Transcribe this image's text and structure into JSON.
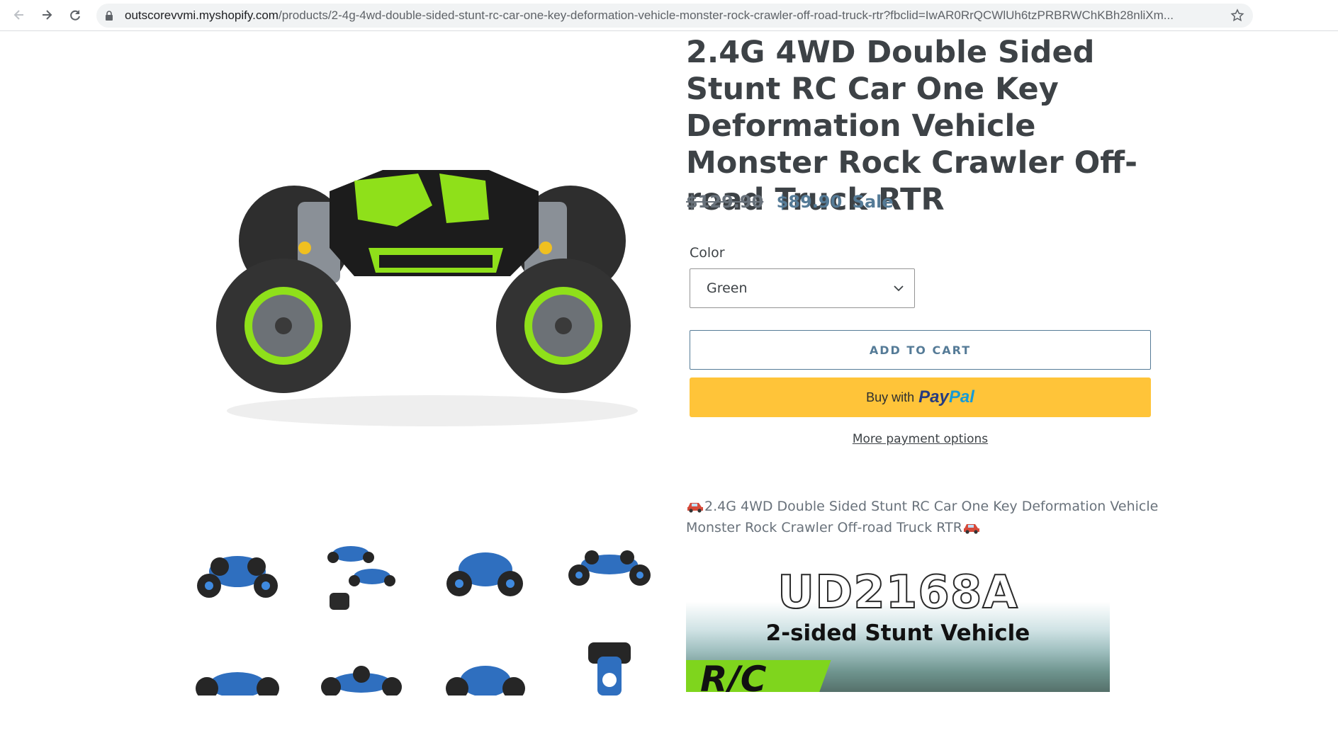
{
  "browser": {
    "url_domain": "outscorevvmi.myshopify.com",
    "url_path": "/products/2-4g-4wd-double-sided-stunt-rc-car-one-key-deformation-vehicle-monster-rock-crawler-off-road-truck-rtr?fbclid=IwAR0RrQCWlUh6tzPRBRWChKBh28nliXm..."
  },
  "product": {
    "title": "2.4G 4WD Double Sided Stunt RC Car One Key Deformation Vehicle Monster Rock Crawler Off-road Truck RTR",
    "compare_price": "$129.90",
    "price": "$89.90",
    "sale_label": "Sale",
    "option_label": "Color",
    "option_value": "Green",
    "add_to_cart": "ADD TO CART",
    "paypal_buy": "Buy with",
    "paypal_pay": "Pay",
    "paypal_pal": "Pal",
    "more_payment_options": "More payment options",
    "description": "2.4G 4WD Double Sided Stunt RC Car One Key Deformation Vehicle Monster Rock Crawler Off-road Truck RTR"
  },
  "description_image": {
    "model": "UD2168A",
    "subtitle": "2-sided Stunt Vehicle",
    "badge": "R/C"
  },
  "icons": [
    "back-arrow-icon",
    "forward-arrow-icon",
    "reload-icon",
    "lock-icon",
    "star-icon",
    "chevron-down-icon",
    "car-icon"
  ],
  "colors": {
    "accent": "#557b97",
    "text": "#3d4246",
    "muted": "#69727b",
    "paypal_yellow": "#ffc439",
    "truck_green": "#8fe01a"
  }
}
